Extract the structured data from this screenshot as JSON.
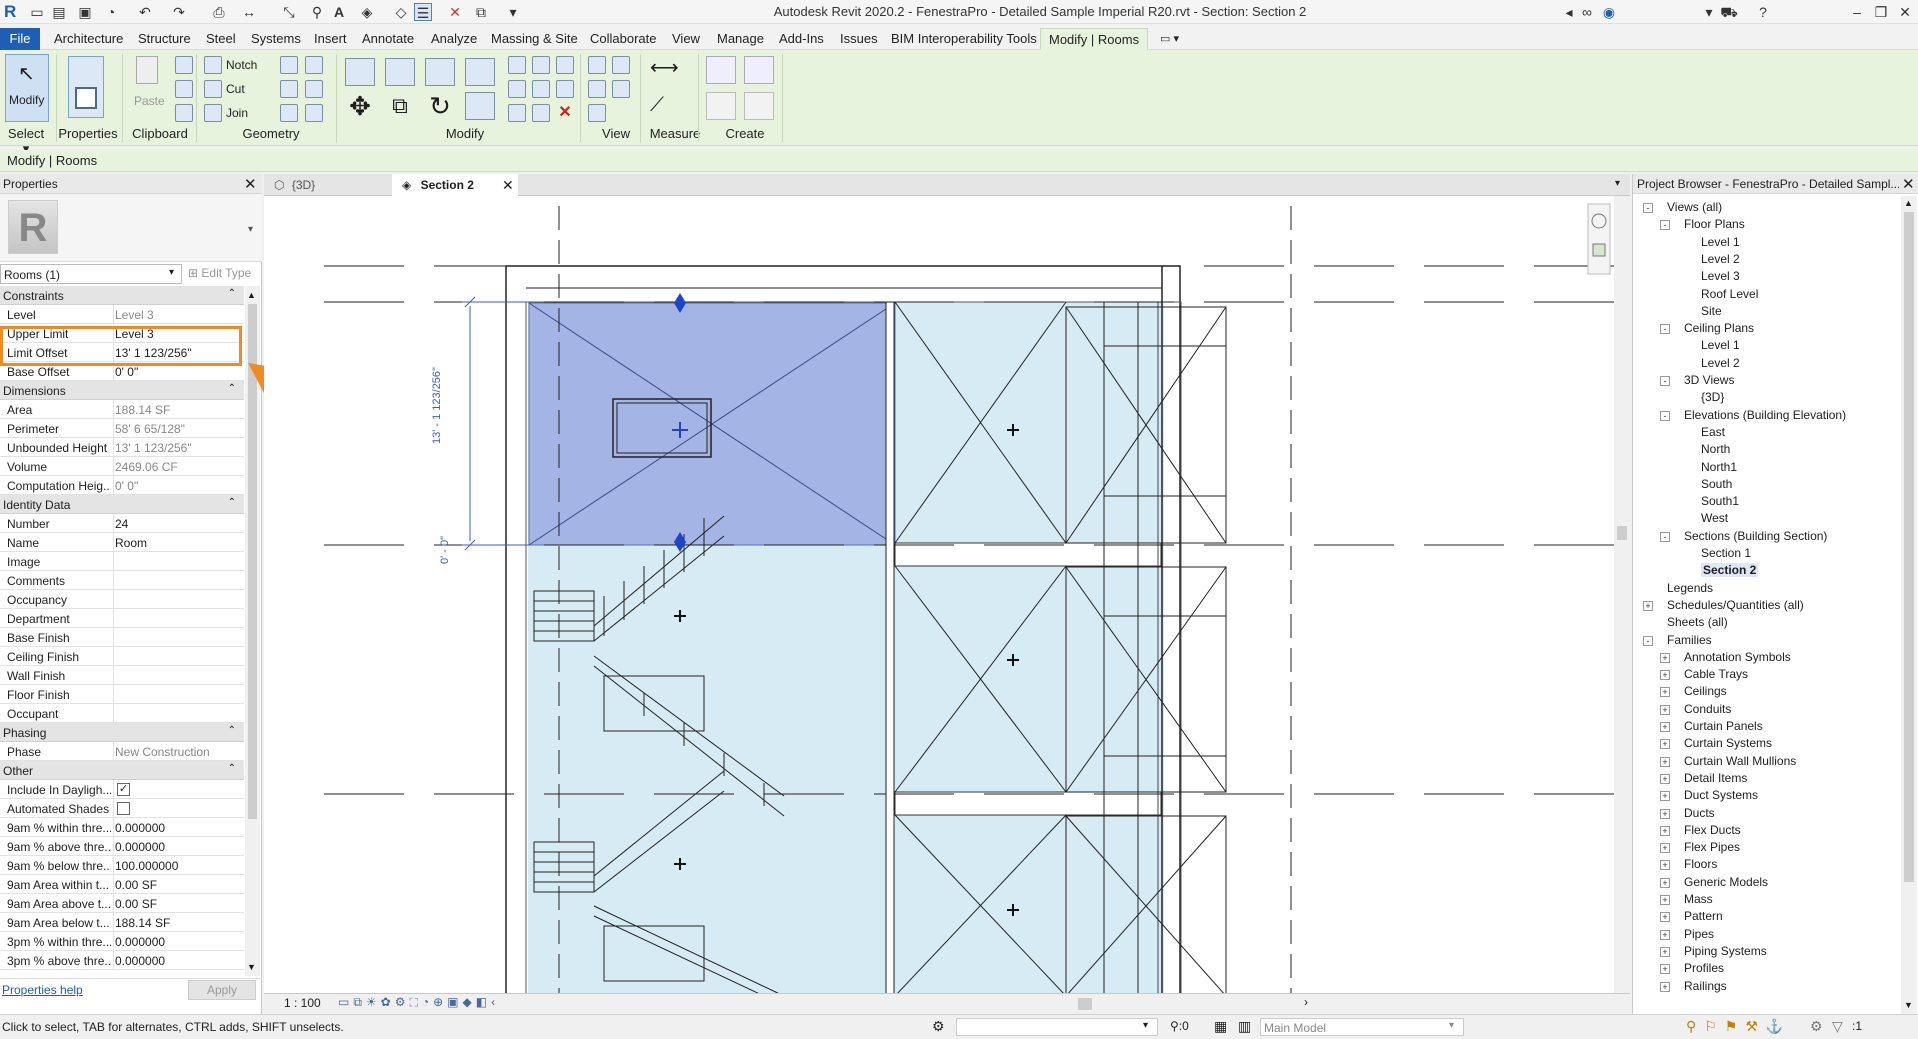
{
  "app": {
    "title": "Autodesk Revit 2020.2 - FenestraPro - Detailed Sample Imperial R20.rvt - Section: Section 2"
  },
  "menu_tabs": [
    "File",
    "Architecture",
    "Structure",
    "Steel",
    "Systems",
    "Insert",
    "Annotate",
    "Analyze",
    "Massing & Site",
    "Collaborate",
    "View",
    "Manage",
    "Add-Ins",
    "Issues",
    "BIM Interoperability Tools",
    "Modify | Rooms"
  ],
  "ribbon": {
    "modify_label": "Modify",
    "paste_label": "Paste",
    "notch_label": "Notch",
    "cut_label": "Cut",
    "join_label": "Join",
    "groups": [
      "Select",
      "Properties",
      "Clipboard",
      "Geometry",
      "Modify",
      "View",
      "Measure",
      "Create"
    ]
  },
  "context_bar": "Modify | Rooms",
  "properties": {
    "header": "Properties",
    "selector": "Rooms (1)",
    "edit_type": "Edit Type",
    "sections": [
      {
        "title": "Constraints",
        "rows": [
          {
            "k": "Level",
            "v": "Level 3",
            "dim": true
          },
          {
            "k": "Upper Limit",
            "v": "Level 3"
          },
          {
            "k": "Limit Offset",
            "v": "13'  1 123/256\""
          },
          {
            "k": "Base Offset",
            "v": "0'  0\""
          }
        ]
      },
      {
        "title": "Dimensions",
        "rows": [
          {
            "k": "Area",
            "v": "188.14 SF",
            "dim": true
          },
          {
            "k": "Perimeter",
            "v": "58'  6 65/128\"",
            "dim": true
          },
          {
            "k": "Unbounded Height",
            "v": "13'  1 123/256\"",
            "dim": true
          },
          {
            "k": "Volume",
            "v": "2469.06 CF",
            "dim": true
          },
          {
            "k": "Computation Heig...",
            "v": "0'  0\"",
            "dim": true
          }
        ]
      },
      {
        "title": "Identity Data",
        "rows": [
          {
            "k": "Number",
            "v": "24"
          },
          {
            "k": "Name",
            "v": "Room"
          },
          {
            "k": "Image",
            "v": ""
          },
          {
            "k": "Comments",
            "v": ""
          },
          {
            "k": "Occupancy",
            "v": ""
          },
          {
            "k": "Department",
            "v": ""
          },
          {
            "k": "Base Finish",
            "v": ""
          },
          {
            "k": "Ceiling Finish",
            "v": ""
          },
          {
            "k": "Wall Finish",
            "v": ""
          },
          {
            "k": "Floor Finish",
            "v": ""
          },
          {
            "k": "Occupant",
            "v": ""
          }
        ]
      },
      {
        "title": "Phasing",
        "rows": [
          {
            "k": "Phase",
            "v": "New Construction",
            "dim": true
          }
        ]
      },
      {
        "title": "Other",
        "rows": [
          {
            "k": "Include In Dayligh...",
            "v": "",
            "check": true
          },
          {
            "k": "Automated Shades",
            "v": "",
            "check": false
          },
          {
            "k": "9am % within thre...",
            "v": "0.000000"
          },
          {
            "k": "9am % above thre...",
            "v": "0.000000"
          },
          {
            "k": "9am % below thre...",
            "v": "100.000000"
          },
          {
            "k": "9am Area within t...",
            "v": "0.00 SF"
          },
          {
            "k": "9am Area above t...",
            "v": "0.00 SF"
          },
          {
            "k": "9am Area below t...",
            "v": "188.14 SF"
          },
          {
            "k": "3pm % within thre...",
            "v": "0.000000"
          },
          {
            "k": "3pm % above thre...",
            "v": "0.000000"
          }
        ]
      }
    ],
    "help_link": "Properties help",
    "apply_label": "Apply"
  },
  "view_tabs": [
    {
      "label": "{3D}"
    },
    {
      "label": "Section 2"
    }
  ],
  "canvas": {
    "dim_upper": "13' - 1 123/256\"",
    "dim_lower": "0' - 0\"",
    "room_color": "#a4b4e4",
    "light_color": "#d6ebf4"
  },
  "view_bar": {
    "scale": "1 : 100"
  },
  "project_browser": {
    "title": "Project Browser - FenestraPro - Detailed Sampl...",
    "nodes": [
      {
        "label": "Views (all)",
        "depth": 0,
        "exp": "-"
      },
      {
        "label": "Floor Plans",
        "depth": 1,
        "exp": "-"
      },
      {
        "label": "Level 1",
        "depth": 2
      },
      {
        "label": "Level 2",
        "depth": 2
      },
      {
        "label": "Level 3",
        "depth": 2
      },
      {
        "label": "Roof Level",
        "depth": 2
      },
      {
        "label": "Site",
        "depth": 2
      },
      {
        "label": "Ceiling Plans",
        "depth": 1,
        "exp": "-"
      },
      {
        "label": "Level 1",
        "depth": 2
      },
      {
        "label": "Level 2",
        "depth": 2
      },
      {
        "label": "3D Views",
        "depth": 1,
        "exp": "-"
      },
      {
        "label": "{3D}",
        "depth": 2
      },
      {
        "label": "Elevations (Building Elevation)",
        "depth": 1,
        "exp": "-"
      },
      {
        "label": "East",
        "depth": 2
      },
      {
        "label": "North",
        "depth": 2
      },
      {
        "label": "North1",
        "depth": 2
      },
      {
        "label": "South",
        "depth": 2
      },
      {
        "label": "South1",
        "depth": 2
      },
      {
        "label": "West",
        "depth": 2
      },
      {
        "label": "Sections (Building Section)",
        "depth": 1,
        "exp": "-"
      },
      {
        "label": "Section 1",
        "depth": 2
      },
      {
        "label": "Section 2",
        "depth": 2,
        "bold": true
      },
      {
        "label": "Legends",
        "depth": 0
      },
      {
        "label": "Schedules/Quantities (all)",
        "depth": 0,
        "exp": "+"
      },
      {
        "label": "Sheets (all)",
        "depth": 0
      },
      {
        "label": "Families",
        "depth": 0,
        "exp": "-"
      },
      {
        "label": "Annotation Symbols",
        "depth": 1,
        "exp": "+"
      },
      {
        "label": "Cable Trays",
        "depth": 1,
        "exp": "+"
      },
      {
        "label": "Ceilings",
        "depth": 1,
        "exp": "+"
      },
      {
        "label": "Conduits",
        "depth": 1,
        "exp": "+"
      },
      {
        "label": "Curtain Panels",
        "depth": 1,
        "exp": "+"
      },
      {
        "label": "Curtain Systems",
        "depth": 1,
        "exp": "+"
      },
      {
        "label": "Curtain Wall Mullions",
        "depth": 1,
        "exp": "+"
      },
      {
        "label": "Detail Items",
        "depth": 1,
        "exp": "+"
      },
      {
        "label": "Duct Systems",
        "depth": 1,
        "exp": "+"
      },
      {
        "label": "Ducts",
        "depth": 1,
        "exp": "+"
      },
      {
        "label": "Flex Ducts",
        "depth": 1,
        "exp": "+"
      },
      {
        "label": "Flex Pipes",
        "depth": 1,
        "exp": "+"
      },
      {
        "label": "Floors",
        "depth": 1,
        "exp": "+"
      },
      {
        "label": "Generic Models",
        "depth": 1,
        "exp": "+"
      },
      {
        "label": "Mass",
        "depth": 1,
        "exp": "+"
      },
      {
        "label": "Pattern",
        "depth": 1,
        "exp": "+"
      },
      {
        "label": "Pipes",
        "depth": 1,
        "exp": "+"
      },
      {
        "label": "Piping Systems",
        "depth": 1,
        "exp": "+"
      },
      {
        "label": "Profiles",
        "depth": 1,
        "exp": "+"
      },
      {
        "label": "Railings",
        "depth": 1,
        "exp": "+"
      }
    ]
  },
  "status": {
    "hint": "Click to select, TAB for alternates, CTRL adds, SHIFT unselects.",
    "workset_count": ":0",
    "model": "Main Model",
    "filter_count": ":1"
  },
  "colors": {
    "accent": "#1e5fb4",
    "highlight": "#f08a24",
    "ribbon": "#e8f3de"
  }
}
